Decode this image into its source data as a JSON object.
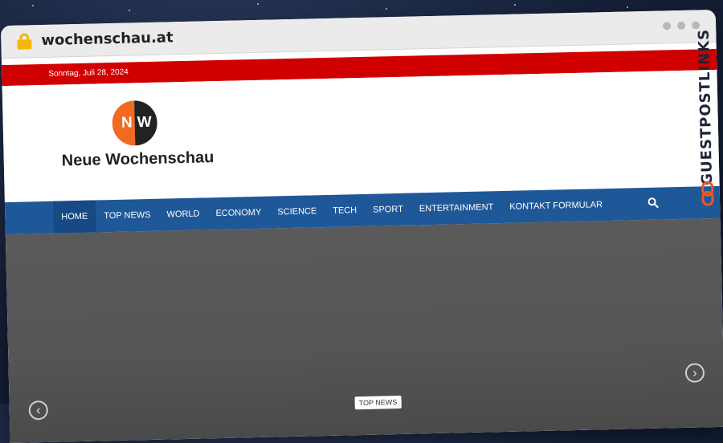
{
  "browser": {
    "url": "wochenschau.at"
  },
  "topbar": {
    "date": "Sonntag, Juli 28, 2024"
  },
  "header": {
    "logo_left": "N",
    "logo_right": "W",
    "site_title": "Neue Wochenschau"
  },
  "nav": {
    "items": [
      {
        "label": "HOME"
      },
      {
        "label": "TOP NEWS"
      },
      {
        "label": "WORLD"
      },
      {
        "label": "ECONOMY"
      },
      {
        "label": "SCIENCE"
      },
      {
        "label": "TECH"
      },
      {
        "label": "SPORT"
      },
      {
        "label": "ENTERTAINMENT"
      },
      {
        "label": "KONTAKT FORMULAR"
      }
    ]
  },
  "hero": {
    "badge": "TOP NEWS",
    "prev_symbol": "‹",
    "next_symbol": "›"
  },
  "watermark": {
    "text": "GUESTPOSTLINKS"
  },
  "colors": {
    "topbar": "#d10000",
    "nav": "#1f5898",
    "logo_orange": "#f26a21",
    "logo_dark": "#222222"
  }
}
